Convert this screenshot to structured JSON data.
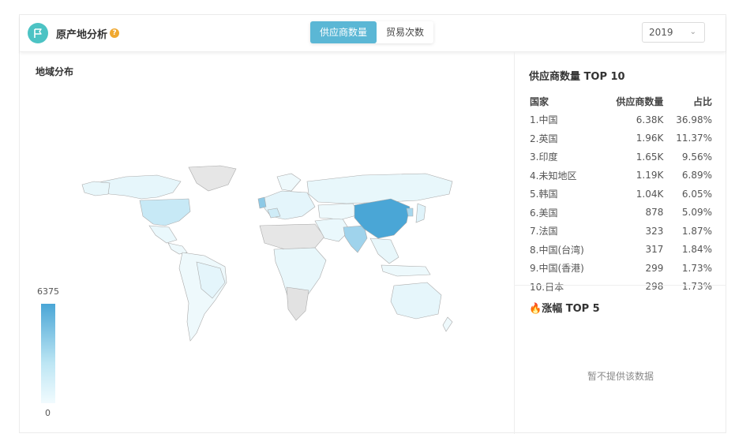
{
  "header": {
    "title": "原产地分析",
    "help_icon": "question-icon",
    "tabs": [
      {
        "label": "供应商数量",
        "active": true
      },
      {
        "label": "贸易次数",
        "active": false
      }
    ],
    "year": "2019",
    "accent_color": "#5bb7d5",
    "logo_color": "#4cc3c4"
  },
  "map": {
    "title": "地域分布",
    "legend_max": "6375",
    "legend_min": "0",
    "highlight_color": "#4aa6d6"
  },
  "top10": {
    "title": "供应商数量 TOP 10",
    "columns": [
      "国家",
      "供应商数量",
      "占比"
    ],
    "rows": [
      [
        "1.中国",
        "6.38K",
        "36.98%"
      ],
      [
        "2.英国",
        "1.96K",
        "11.37%"
      ],
      [
        "3.印度",
        "1.65K",
        "9.56%"
      ],
      [
        "4.未知地区",
        "1.19K",
        "6.89%"
      ],
      [
        "5.韩国",
        "1.04K",
        "6.05%"
      ],
      [
        "6.美国",
        "878",
        "5.09%"
      ],
      [
        "7.法国",
        "323",
        "1.87%"
      ],
      [
        "8.中国(台湾)",
        "317",
        "1.84%"
      ],
      [
        "9.中国(香港)",
        "299",
        "1.73%"
      ],
      [
        "10.日本",
        "298",
        "1.73%"
      ]
    ]
  },
  "top5": {
    "icon": "fire-icon",
    "title": "涨幅 TOP 5",
    "empty_text": "暂不提供该数据"
  }
}
